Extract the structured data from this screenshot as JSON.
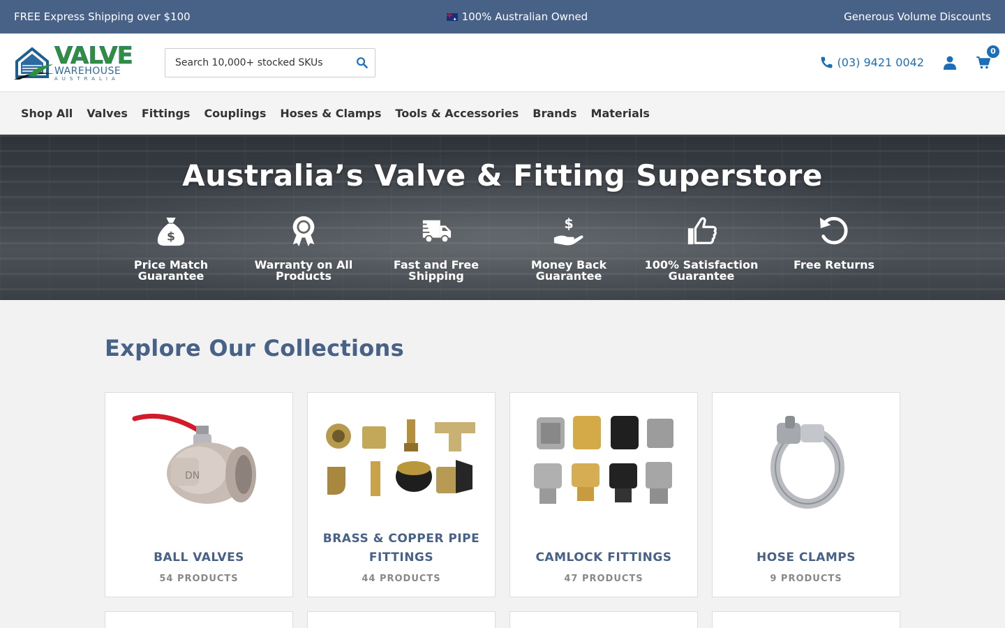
{
  "topbar": {
    "left": "FREE Express Shipping over $100",
    "center": "100% Australian Owned",
    "right": "Generous Volume Discounts"
  },
  "header": {
    "logo": {
      "line1": "VALVE",
      "line2": "WAREHOUSE",
      "line3": "AUSTRALIA"
    },
    "search": {
      "placeholder": "Search 10,000+ stocked SKUs"
    },
    "phone": "(03) 9421 0042",
    "cart_count": "0"
  },
  "nav": {
    "items": [
      "Shop All",
      "Valves",
      "Fittings",
      "Couplings",
      "Hoses & Clamps",
      "Tools & Accessories",
      "Brands",
      "Materials"
    ]
  },
  "hero": {
    "title": "Australia’s Valve & Fitting Superstore",
    "features": [
      {
        "icon": "money-bag-icon",
        "label": "Price Match Guarantee"
      },
      {
        "icon": "award-ribbon-icon",
        "label": "Warranty on All Products"
      },
      {
        "icon": "shipping-truck-icon",
        "label": "Fast and Free Shipping"
      },
      {
        "icon": "hand-dollar-icon",
        "label": "Money Back Guarantee"
      },
      {
        "icon": "thumbs-up-icon",
        "label": "100% Satisfaction Guarantee"
      },
      {
        "icon": "undo-arrow-icon",
        "label": "Free Returns"
      }
    ]
  },
  "collections": {
    "heading": "Explore Our Collections",
    "items": [
      {
        "title": "BALL VALVES",
        "count": "54 PRODUCTS"
      },
      {
        "title": "BRASS & COPPER PIPE FITTINGS",
        "count": "44 PRODUCTS"
      },
      {
        "title": "CAMLOCK FITTINGS",
        "count": "47 PRODUCTS"
      },
      {
        "title": "HOSE CLAMPS",
        "count": "9 PRODUCTS"
      }
    ]
  },
  "colors": {
    "topbar": "#476187",
    "accent_blue": "#1a6fb8",
    "heading": "#476187"
  }
}
